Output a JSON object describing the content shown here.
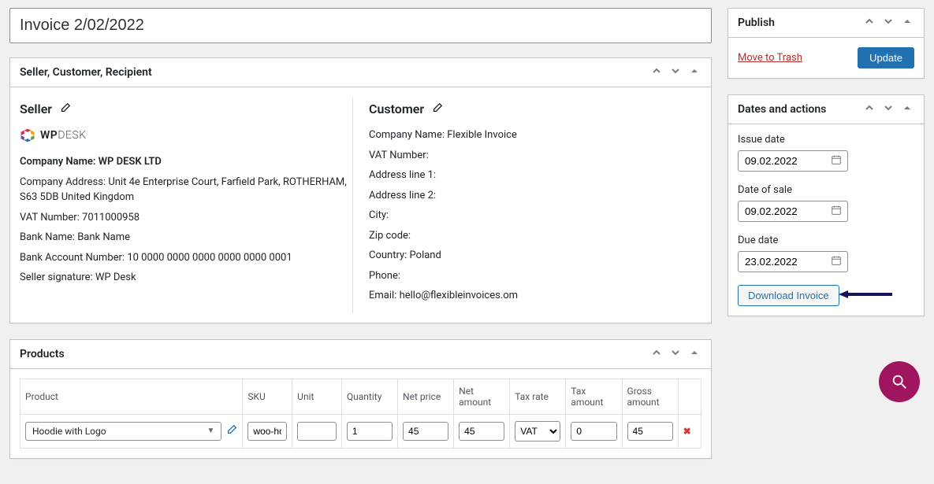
{
  "title": "Invoice 2/02/2022",
  "panels": {
    "scr": {
      "title": "Seller, Customer, Recipient"
    },
    "products": {
      "title": "Products"
    }
  },
  "seller": {
    "heading": "Seller",
    "logo_text_wp": "WP",
    "logo_text_desk": "DESK",
    "company_name_label": "Company Name: ",
    "company_name": "WP DESK LTD",
    "address_label": "Company Address: ",
    "address": "Unit 4e Enterprise Court, Farfield Park, ROTHERHAM, S63 5DB United Kingdom",
    "vat_label": "VAT Number: ",
    "vat": "7011000958",
    "bank_name_label": "Bank Name: ",
    "bank_name": "Bank Name",
    "bank_acct_label": "Bank Account Number: ",
    "bank_acct": "10 0000 0000 0000 0000 0000 0001",
    "signature_label": "Seller signature: ",
    "signature": "WP Desk"
  },
  "customer": {
    "heading": "Customer",
    "company_name_label": "Company Name: ",
    "company_name": "Flexible Invoice",
    "vat_label": "VAT Number:",
    "addr1_label": "Address line 1:",
    "addr2_label": "Address line 2:",
    "city_label": "City:",
    "zip_label": "Zip code:",
    "country_label": "Country: ",
    "country": "Poland",
    "phone_label": "Phone:",
    "email_label": "Email: ",
    "email": "hello@flexibleinvoices.om"
  },
  "products": {
    "headers": {
      "product": "Product",
      "sku": "SKU",
      "unit": "Unit",
      "qty": "Quantity",
      "net_price": "Net price",
      "net_amount": "Net amount",
      "tax_rate": "Tax rate",
      "tax_amount": "Tax amount",
      "gross_amount": "Gross amount"
    },
    "row": {
      "product": "Hoodie with Logo",
      "sku": "woo-ho",
      "unit": "",
      "qty": "1",
      "net_price": "45",
      "net_amount": "45",
      "tax_rate": "VAT",
      "tax_amount": "0",
      "gross_amount": "45"
    }
  },
  "publish": {
    "title": "Publish",
    "move_trash": "Move to Trash",
    "update": "Update"
  },
  "dates": {
    "title": "Dates and actions",
    "issue_label": "Issue date",
    "issue_value": "09.02.2022",
    "sale_label": "Date of sale",
    "sale_value": "09.02.2022",
    "due_label": "Due date",
    "due_value": "23.02.2022",
    "download": "Download Invoice"
  },
  "colors": {
    "primary": "#2271b1",
    "danger": "#b32d2e",
    "fab": "#a0165e"
  }
}
